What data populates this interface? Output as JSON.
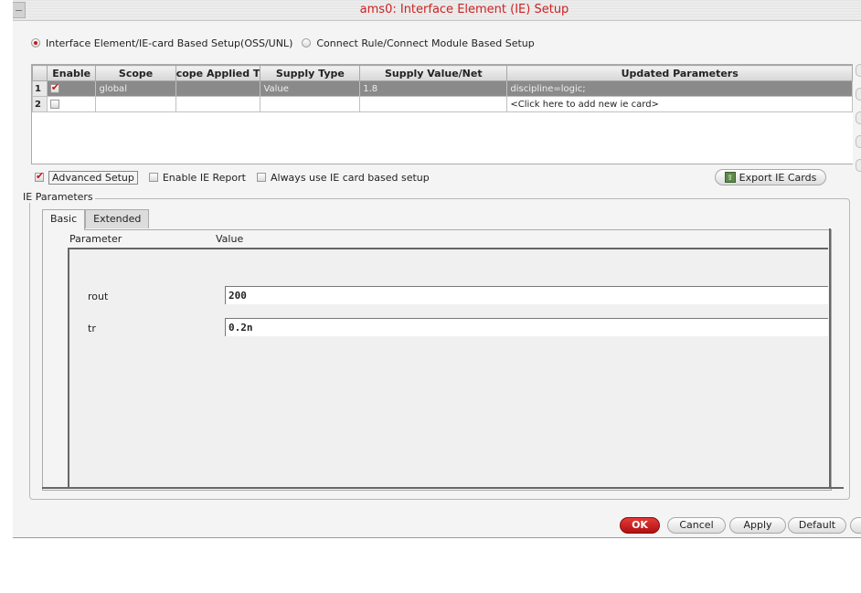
{
  "window": {
    "title": "ams0: Interface Element (IE) Setup"
  },
  "mode": {
    "option1": "Interface Element/IE-card Based Setup(OSS/UNL)",
    "option2": "Connect Rule/Connect Module Based Setup",
    "selected": "option1"
  },
  "table": {
    "columns": [
      "Enable",
      "Scope",
      "cope Applied T",
      "Supply Type",
      "Supply Value/Net",
      "Updated Parameters"
    ],
    "rows": [
      {
        "num": "1",
        "enabled": true,
        "scope": "global",
        "applied": "",
        "supply_type": "Value",
        "supply_value": "1.8",
        "updated": "discipline=logic;"
      },
      {
        "num": "2",
        "enabled": false,
        "scope": "",
        "applied": "",
        "supply_type": "",
        "supply_value": "",
        "updated": "<Click here to add new ie card>"
      }
    ]
  },
  "options": {
    "advanced_setup": {
      "label": "Advanced Setup",
      "checked": true
    },
    "enable_ie_report": {
      "label": "Enable IE Report",
      "checked": false
    },
    "always_use_ie_card": {
      "label": "Always use IE card based setup",
      "checked": false
    }
  },
  "export_button": "Export IE Cards",
  "ie_parameters": {
    "group_label": "IE Parameters",
    "tabs": [
      "Basic",
      "Extended"
    ],
    "active_tab": "Basic",
    "headers": {
      "parameter": "Parameter",
      "value": "Value"
    },
    "params": [
      {
        "name": "rout",
        "value": "200"
      },
      {
        "name": "tr",
        "value": "0.2n"
      }
    ]
  },
  "buttons": {
    "ok": "OK",
    "cancel": "Cancel",
    "apply": "Apply",
    "default": "Default"
  },
  "colors": {
    "accent": "#cc2222",
    "selected_row": "#8a8a8a"
  }
}
